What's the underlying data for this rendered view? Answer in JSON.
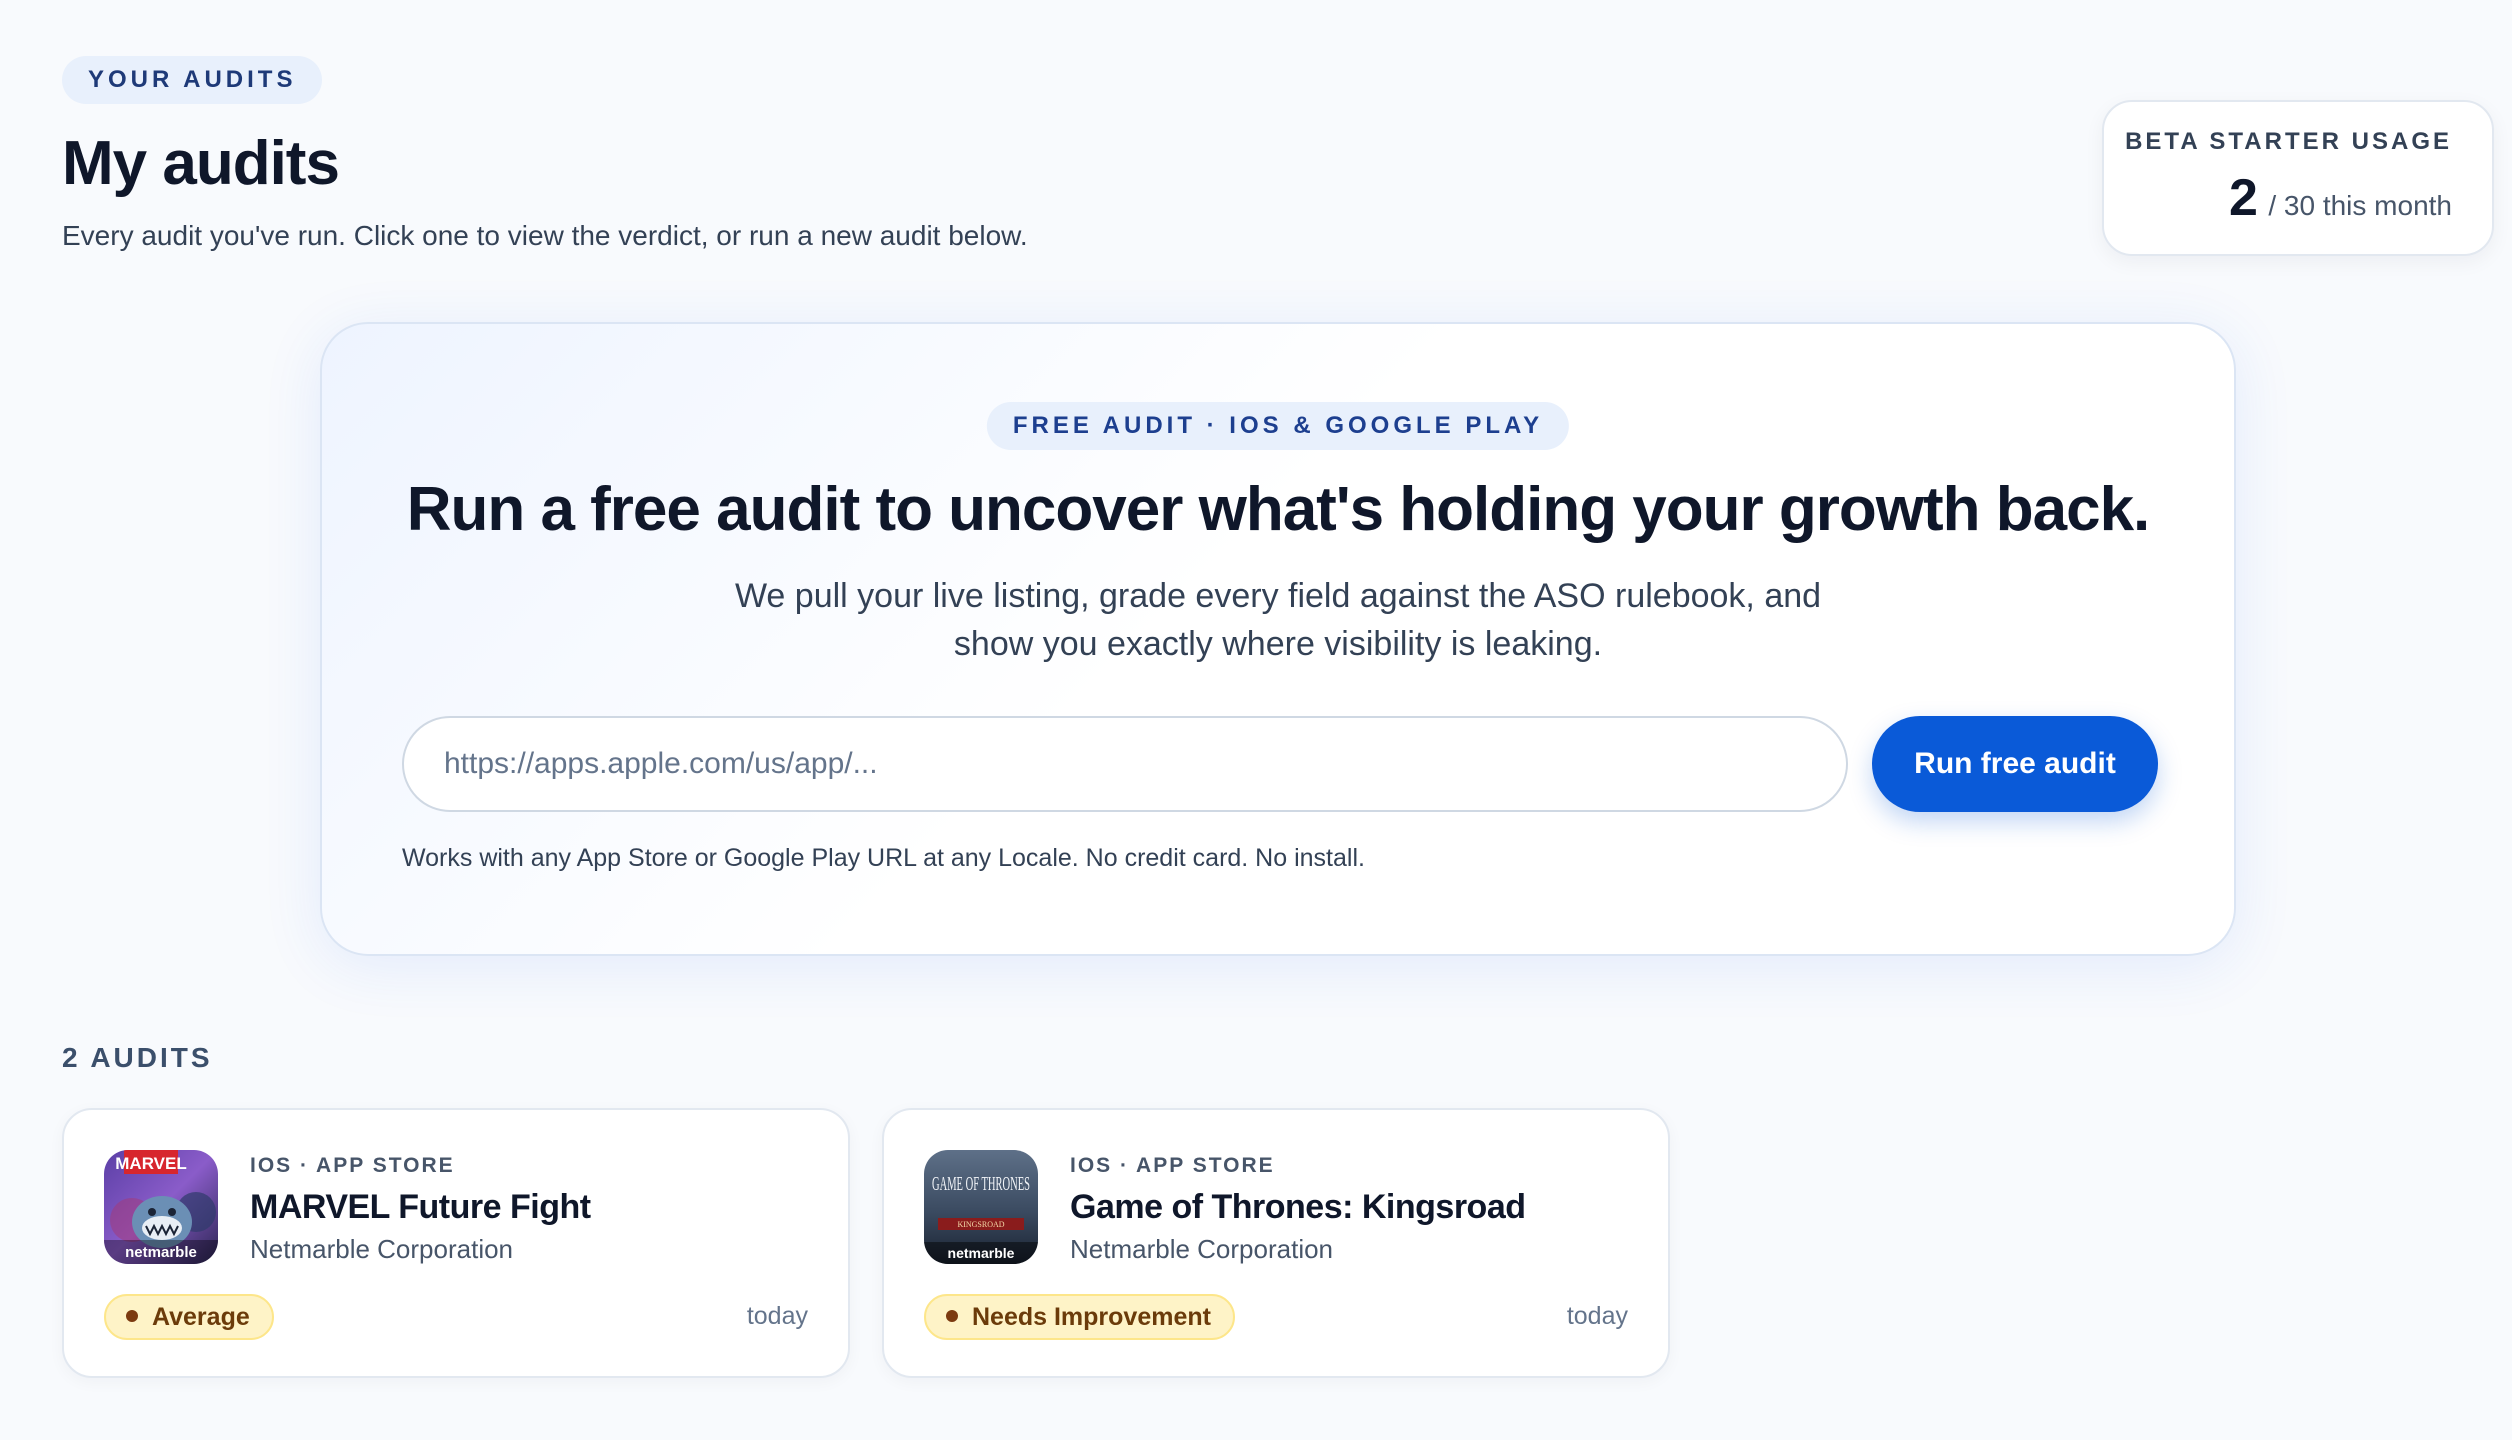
{
  "header": {
    "eyebrow": "YOUR AUDITS",
    "title": "My audits",
    "subtitle": "Every audit you've run. Click one to view the verdict, or run a new audit below."
  },
  "usage": {
    "label": "BETA STARTER USAGE",
    "count": "2",
    "suffix": "/ 30 this month"
  },
  "hero": {
    "pill": "FREE AUDIT · IOS & GOOGLE PLAY",
    "title": "Run a free audit to uncover what's holding your growth back.",
    "description": "We pull your live listing, grade every field against the ASO rulebook, and show you exactly where visibility is leaking.",
    "input_value": "",
    "input_placeholder": "https://apps.apple.com/us/app/...",
    "button_label": "Run free audit",
    "footnote": "Works with any App Store or Google Play URL at any Locale. No credit card. No install."
  },
  "audits": {
    "heading": "2 AUDITS",
    "items": [
      {
        "store": "IOS · APP STORE",
        "name": "MARVEL Future Fight",
        "developer": "Netmarble Corporation",
        "status": "Average",
        "date": "today",
        "icon": "marvel-future-fight-app-icon",
        "icon_text": [
          "MARVEL",
          "netmarble"
        ]
      },
      {
        "store": "IOS · APP STORE",
        "name": "Game of Thrones: Kingsroad",
        "developer": "Netmarble Corporation",
        "status": "Needs Improvement",
        "date": "today",
        "icon": "game-of-thrones-kingsroad-app-icon",
        "icon_text": [
          "GAME OF THRONES",
          "KINGSROAD",
          "netmarble"
        ]
      }
    ]
  },
  "colors": {
    "accent": "#0a5ad8",
    "badge_bg": "#fef3c7",
    "badge_text": "#6b3b0a",
    "pill_bg": "#e8f0fc"
  }
}
